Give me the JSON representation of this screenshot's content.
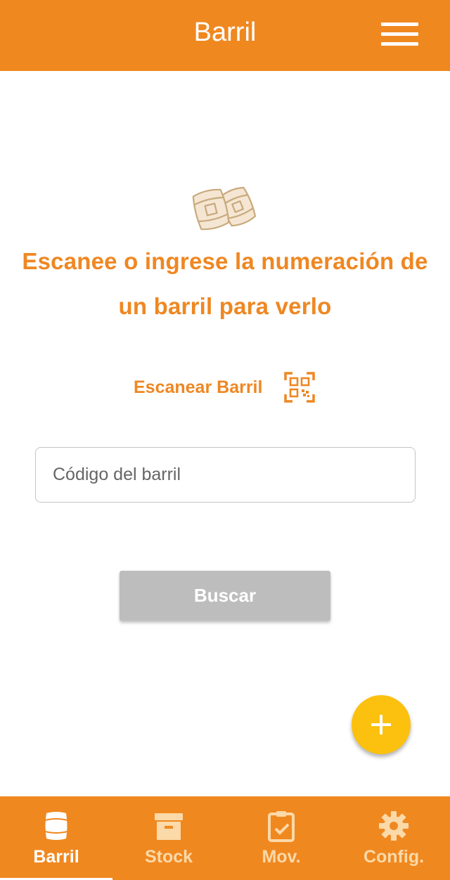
{
  "header": {
    "title": "Barril",
    "menu_icon": "hamburger-menu-icon"
  },
  "main": {
    "illustration_icon": "barrels-icon",
    "prompt": "Escanee o ingrese la numeración de un barril para verlo",
    "scan_label": "Escanear Barril",
    "scan_icon": "qr-code-icon",
    "code_input": {
      "value": "",
      "placeholder": "Código del barril"
    },
    "search_label": "Buscar",
    "fab_icon": "plus-icon"
  },
  "bottom_nav": {
    "tabs": [
      {
        "label": "Barril",
        "icon": "barrel-icon",
        "active": true
      },
      {
        "label": "Stock",
        "icon": "archive-box-icon",
        "active": false
      },
      {
        "label": "Mov.",
        "icon": "clipboard-check-icon",
        "active": false
      },
      {
        "label": "Config.",
        "icon": "gear-icon",
        "active": false
      }
    ]
  },
  "colors": {
    "primary": "#f08820",
    "accent_text": "#ef8722",
    "fab": "#fcc10f",
    "button_disabled": "#bdbdbd",
    "inactive_tab": "#fbd9a8"
  }
}
